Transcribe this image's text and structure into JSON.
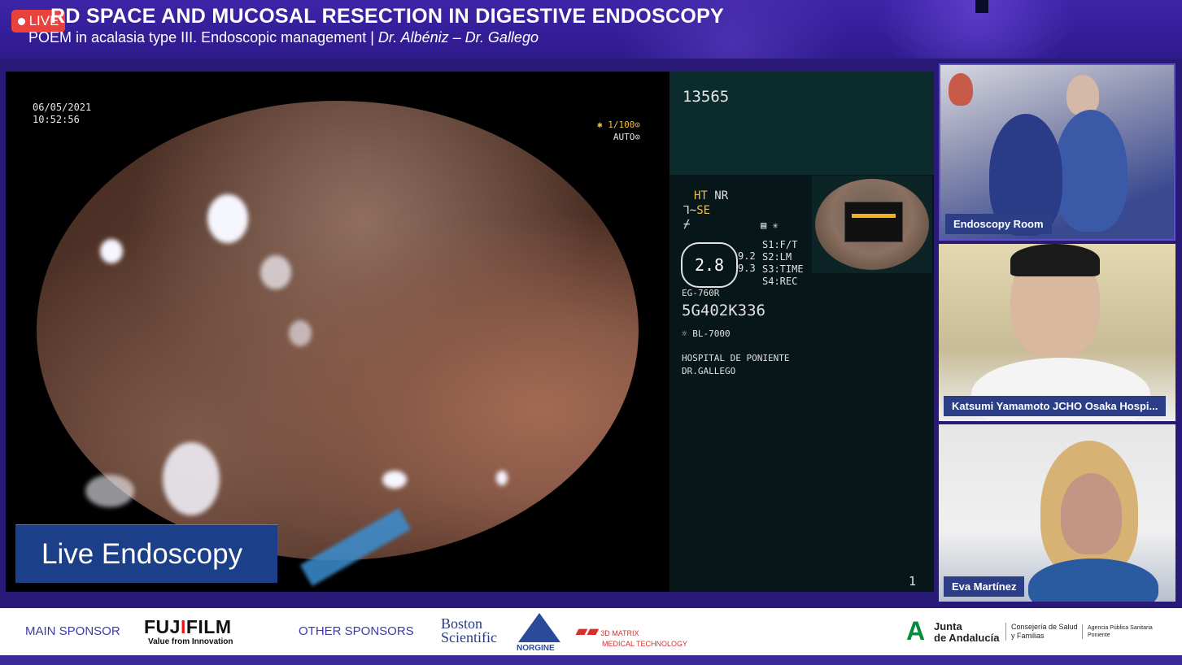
{
  "header": {
    "live_label": "LIVE",
    "title": "RD SPACE AND MUCOSAL RESECTION IN DIGESTIVE ENDOSCOPY",
    "subtitle_main": "POEM in acalasia type III. Endoscopic management | ",
    "subtitle_authors": "Dr. Albéniz – Dr. Gallego"
  },
  "endoscope": {
    "date": "06/05/2021",
    "time": "10:52:56",
    "zoom": "✱ 1/100⊙",
    "mode": "AUTO⊙",
    "patient_id": "13565",
    "ht": "HT",
    "nr": "NR",
    "se": "SE",
    "gauge": "2.8",
    "g_values": [
      "9.2",
      "9.3"
    ],
    "switches": [
      "S1:F/T",
      "S2:LM",
      "S3:TIME",
      "S4:REC"
    ],
    "model": "EG-760R",
    "serial": "5G402K336",
    "light": "BL-7000",
    "hospital": "HOSPITAL DE PONIENTE",
    "doctor": "DR.GALLEGO",
    "page_number": "1",
    "overlay_label": "Live Endoscopy"
  },
  "participants": [
    {
      "name": "Endoscopy Room"
    },
    {
      "name": "Katsumi Yamamoto JCHO Osaka Hospi..."
    },
    {
      "name": "Eva Martínez"
    }
  ],
  "footer": {
    "main_sponsor_label": "MAIN SPONSOR",
    "fujifilm_left": "FUJ",
    "fujifilm_i": "I",
    "fujifilm_right": "FILM",
    "fujifilm_tagline": "Value from Innovation",
    "other_sponsors_label": "OTHER SPONSORS",
    "boston_line1": "Boston",
    "boston_line2": "Scientific",
    "norgine": "NORGINE",
    "matrix": "3D MATRIX",
    "matrix_sub": "MEDICAL TECHNOLOGY",
    "junta_line1": "Junta",
    "junta_line2": "de Andalucía",
    "consejeria_line1": "Consejería de Salud",
    "consejeria_line2": "y Familias",
    "agencia_line1": "Agencia Pública Sanitaria",
    "agencia_line2": "Poniente"
  },
  "colors": {
    "brand_purple": "#2e1a8c",
    "live_red": "#e8413e",
    "badge_blue": "#1b3f88",
    "tag_blue": "#2b3e86"
  }
}
